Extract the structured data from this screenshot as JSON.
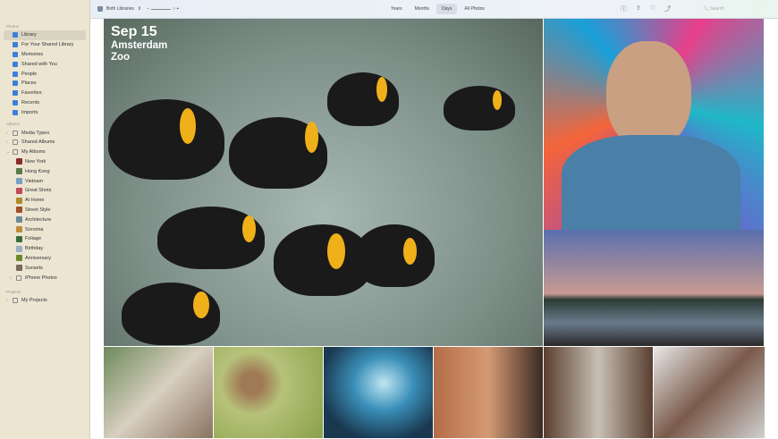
{
  "sidebar": {
    "photos_header": "Photos",
    "photos_items": [
      "Library",
      "For Your Shared Library",
      "Memories",
      "Shared with You",
      "People",
      "Places",
      "Favorites",
      "Recents",
      "Imports"
    ],
    "albums_header": "Albums",
    "album_groups": [
      "Media Types",
      "Shared Albums",
      "My Albums"
    ],
    "my_albums": [
      "New York",
      "Hong Kong",
      "Vietnam",
      "Great Shots",
      "At Home",
      "Street Style",
      "Architecture",
      "Sonoma",
      "Foliage",
      "Birthday",
      "Anniversary",
      "Sunsets"
    ],
    "iphone_folder": "iPhone Photos",
    "projects_header": "Projects",
    "projects": "My Projects"
  },
  "toolbar": {
    "library_select": "Both Libraries",
    "tabs": [
      "Years",
      "Months",
      "Days",
      "All Photos"
    ],
    "active_tab": "Days",
    "search_placeholder": "Search"
  },
  "hero": {
    "date": "Sep 15",
    "title": "Amsterdam Zoo"
  },
  "colors": {
    "sidebar": "#ebe5d2",
    "accent": "#3d7fd9"
  }
}
